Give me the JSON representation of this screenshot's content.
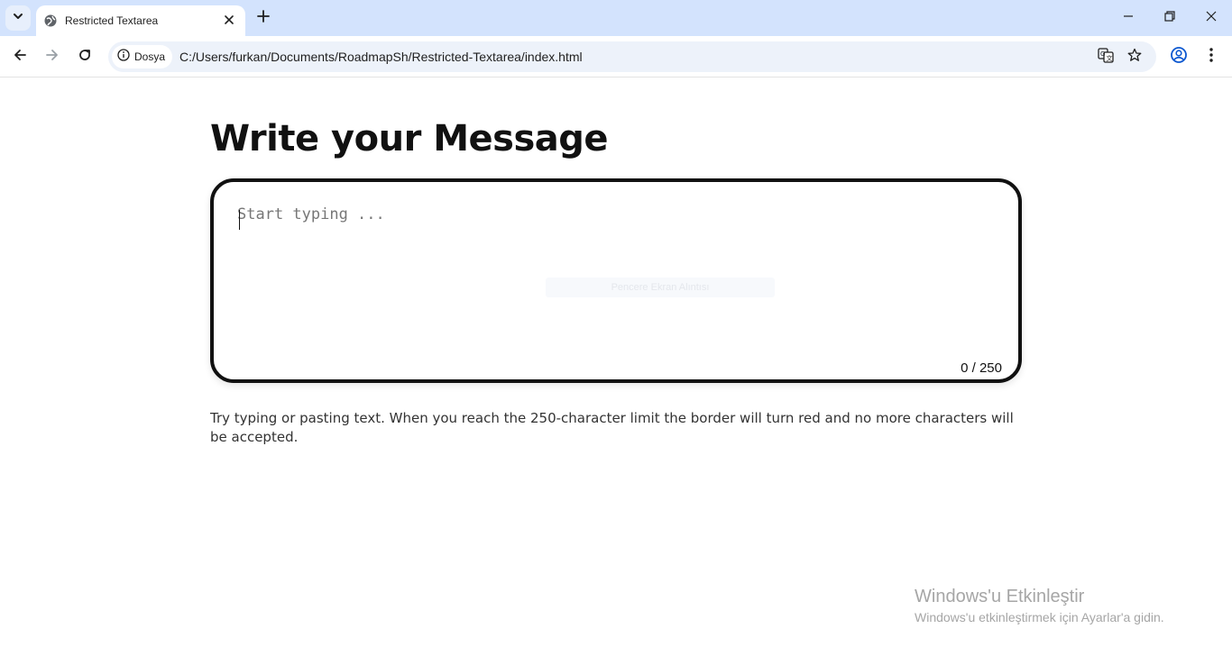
{
  "browser": {
    "tab": {
      "title": "Restricted Textarea"
    },
    "address_bar": {
      "security_chip": "Dosya",
      "url": "C:/Users/furkan/Documents/RoadmapSh/Restricted-Textarea/index.html"
    }
  },
  "page": {
    "title": "Write your Message",
    "textarea": {
      "placeholder": "Start typing ...",
      "value": "",
      "faint_overlay_text": "Pencere Ekran Alıntısı"
    },
    "counter": "0 / 250",
    "helper_text": "Try typing or pasting text. When you reach the 250-character limit the border will turn red and no more characters will be accepted."
  },
  "watermark": {
    "title": "Windows'u Etkinleştir",
    "subtitle": "Windows'u etkinleştirmek için Ayarlar'a gidin."
  },
  "colors": {
    "tabstrip_bg": "#d3e3fd",
    "omnibox_bg": "#edf2fa",
    "textarea_border": "#111111",
    "heading": "#111111"
  },
  "icons": [
    "tab-search-icon",
    "globe-favicon-icon",
    "close-icon",
    "plus-icon",
    "minimize-icon",
    "restore-icon",
    "window-close-icon",
    "back-arrow-icon",
    "forward-arrow-icon",
    "reload-icon",
    "info-icon",
    "translate-icon",
    "star-icon",
    "profile-icon",
    "kebab-menu-icon"
  ]
}
